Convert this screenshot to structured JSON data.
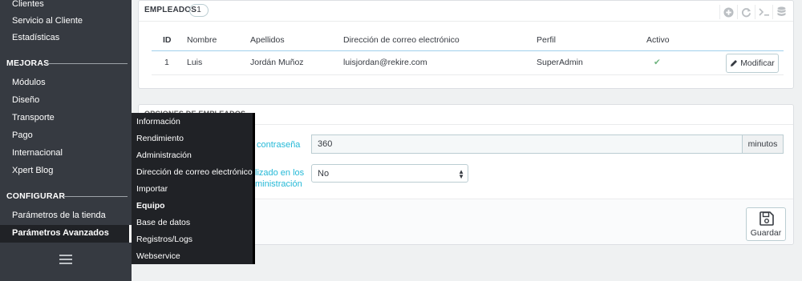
{
  "sidebar": {
    "items_top": [
      "Clientes",
      "Servicio al Cliente",
      "Estadísticas"
    ],
    "section_mejoras": "MEJORAS",
    "items_mejoras": [
      "Módulos",
      "Diseño",
      "Transporte",
      "Pago",
      "Internacional",
      "Xpert Blog"
    ],
    "section_configurar": "CONFIGURAR",
    "items_configurar": [
      "Parámetros de la tienda",
      "Parámetros Avanzados"
    ],
    "active_item": "Parámetros Avanzados"
  },
  "flyout": {
    "items": [
      "Información",
      "Rendimiento",
      "Administración",
      "Dirección de correo electrónico",
      "Importar",
      "Equipo",
      "Base de datos",
      "Registros/Logs",
      "Webservice"
    ],
    "current": "Equipo"
  },
  "employees_panel": {
    "title": "EMPLEADOS",
    "count": "1",
    "toolbar_icons": [
      "add-icon",
      "refresh-icon",
      "sql-query-icon",
      "database-icon"
    ],
    "columns": [
      "ID",
      "Nombre",
      "Apellidos",
      "Dirección de correo electrónico",
      "Perfil",
      "Activo"
    ],
    "rows": [
      {
        "id": "1",
        "first_name": "Luis",
        "last_name": "Jordán Muñoz",
        "email": "luisjordan@rekire.com",
        "profile": "SuperAdmin",
        "active": "✔"
      }
    ],
    "edit_label": "Modificar"
  },
  "options_panel": {
    "title": "OPCIONES DE EMPLEADOS",
    "password_label": "contraseña",
    "password_value": "360",
    "password_unit": "minutos",
    "localized_label_line1": "lizado en los",
    "localized_label_line2": "ministración",
    "localized_value": "No",
    "save_label": "Guardar"
  },
  "colors": {
    "sidebar_bg": "#363a41",
    "flyout_bg": "#202226",
    "accent": "#25b9d7",
    "active_check": "#70b580"
  }
}
